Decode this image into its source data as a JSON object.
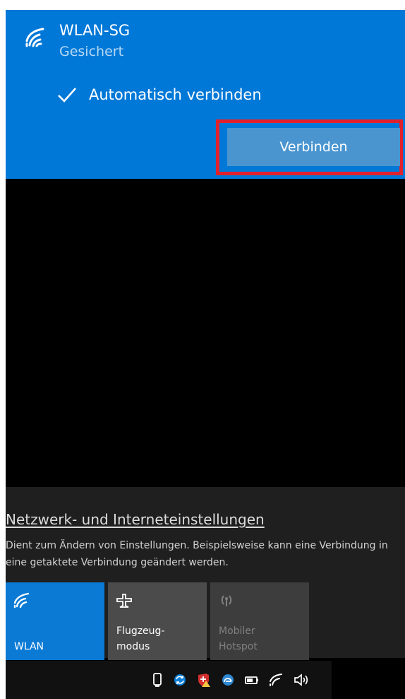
{
  "network": {
    "name": "WLAN-SG",
    "status": "Gesichert",
    "auto_connect_label": "Automatisch verbinden",
    "auto_connect_checked": true,
    "connect_button_label": "Verbinden"
  },
  "settings": {
    "link_label": "Netzwerk- und Interneteinstellungen",
    "description": "Dient zum Ändern von Einstellungen. Beispielsweise kann eine Verbindung in eine getaktete Verbindung geändert werden."
  },
  "quick_actions": [
    {
      "label": "WLAN",
      "icon": "wifi-icon",
      "active": true
    },
    {
      "label": "Flugzeug-\nmodus",
      "icon": "airplane-icon",
      "active": false
    },
    {
      "label": "Mobiler\nHotspot",
      "icon": "hotspot-icon",
      "active": false,
      "disabled": true
    }
  ],
  "taskbar": {
    "icons": [
      "usb-device-icon",
      "sync-icon",
      "security-alert-icon",
      "cloud-sync-icon",
      "battery-icon",
      "wifi-icon",
      "volume-icon"
    ]
  },
  "colors": {
    "accent": "#0078d7",
    "connect_button": "#4a95d0",
    "highlight_border": "#e0212d",
    "flyout_background": "#000000",
    "settings_background": "#1f1f1f",
    "active_tile": "#0a7ad5",
    "inactive_tile": "#4b4b4b",
    "taskbar_background": "#111111"
  }
}
